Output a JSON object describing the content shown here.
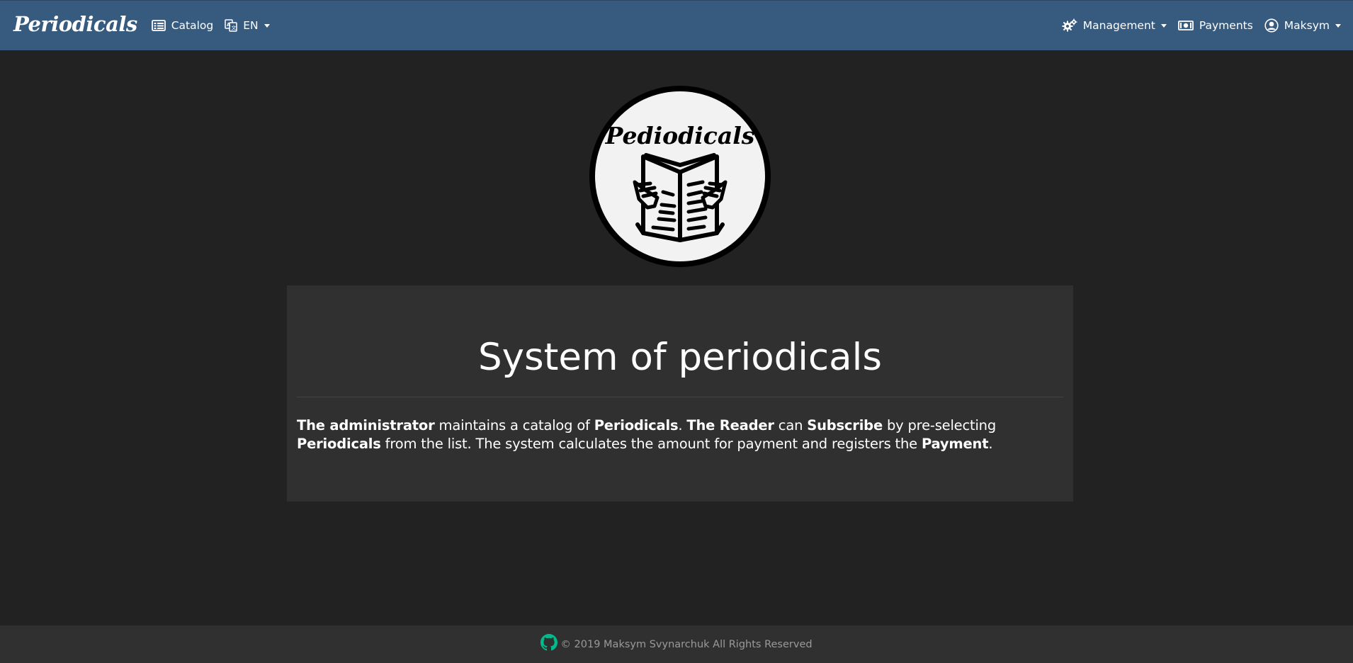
{
  "navbar": {
    "brand": "Periodicals",
    "catalog_label": "Catalog",
    "language_label": "EN",
    "management_label": "Management",
    "payments_label": "Payments",
    "user_label": "Maksym",
    "icons": [
      "catalog-icon",
      "language-icon",
      "gears-icon",
      "money-icon",
      "user-icon"
    ]
  },
  "logo": {
    "text": "Pediodicals"
  },
  "jumbotron": {
    "title": "System of periodicals",
    "description": [
      {
        "text": "The administrator",
        "bold": true
      },
      {
        "text": " maintains a catalog of ",
        "bold": false
      },
      {
        "text": "Periodicals",
        "bold": true
      },
      {
        "text": ". ",
        "bold": false
      },
      {
        "text": "The Reader",
        "bold": true
      },
      {
        "text": " can ",
        "bold": false
      },
      {
        "text": "Subscribe",
        "bold": true
      },
      {
        "text": " by pre-selecting ",
        "bold": false
      },
      {
        "text": "Periodicals",
        "bold": true
      },
      {
        "text": " from the list. The system calculates the amount for payment and registers the ",
        "bold": false
      },
      {
        "text": "Payment",
        "bold": true
      },
      {
        "text": ".",
        "bold": false
      }
    ]
  },
  "footer": {
    "text": "© 2019 Maksym Svynarchuk All Rights Reserved",
    "icon": "github-icon"
  },
  "colors": {
    "navbar_bg": "#375a7f",
    "page_bg": "#222222",
    "panel_bg": "#303030",
    "footer_text": "#9a9a9a",
    "github_icon": "#00bc8c"
  }
}
